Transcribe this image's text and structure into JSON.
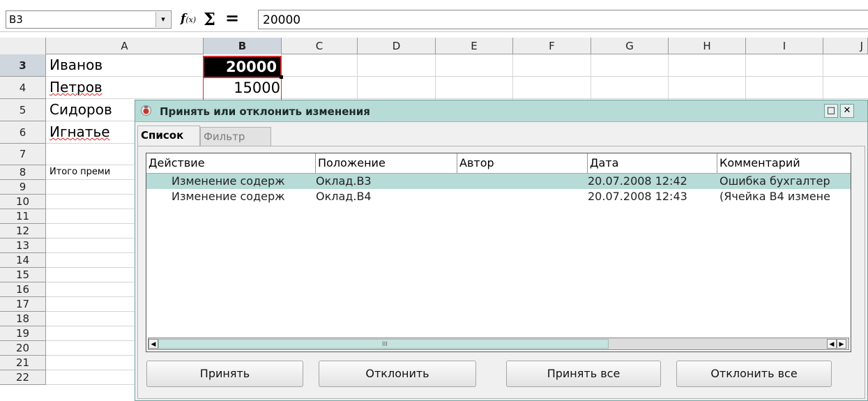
{
  "formula_bar": {
    "name_box": "B3",
    "dropdown_glyph": "▾",
    "fx_label": "f",
    "fx_sub": "(x)",
    "sum_label": "Σ",
    "equals_label": "=",
    "formula_value": "20000"
  },
  "columns": [
    "A",
    "B",
    "C",
    "D",
    "E",
    "F",
    "G",
    "H",
    "I",
    "J"
  ],
  "selected_column": "B",
  "rows": [
    3,
    4,
    5,
    6,
    7,
    8,
    9,
    10,
    11,
    12,
    13,
    14,
    15,
    16,
    17,
    18,
    19,
    20,
    21,
    22
  ],
  "selected_row": 3,
  "cells": {
    "a3": "Иванов",
    "a4": "Петров",
    "a5": "Сидоров",
    "a6": "Игнатье",
    "a8": "Итого преми",
    "b3": "20000",
    "b4": "15000"
  },
  "dialog": {
    "title": "Принять или отклонить изменения",
    "maximize_glyph": "□",
    "close_glyph": "✕",
    "tabs": [
      "Список",
      "Фильтр"
    ],
    "columns": [
      "Действие",
      "Положение",
      "Автор",
      "Дата",
      "Комментарий"
    ],
    "rows": [
      {
        "action": "Изменение содерж",
        "position": "Оклад.B3",
        "author": "",
        "date": "20.07.2008 12:42",
        "comment": "Ошибка бухгалтер"
      },
      {
        "action": "Изменение содерж",
        "position": "Оклад.B4",
        "author": "",
        "date": "20.07.2008 12:43",
        "comment": "(Ячейка B4 измене"
      }
    ],
    "scroll_left_glyph": "◀",
    "scroll_right_glyph": "▶",
    "scroll_grip_glyph": "III",
    "buttons": {
      "accept": "Принять",
      "reject": "Отклонить",
      "accept_all": "Принять все",
      "reject_all": "Отклонить все"
    }
  }
}
